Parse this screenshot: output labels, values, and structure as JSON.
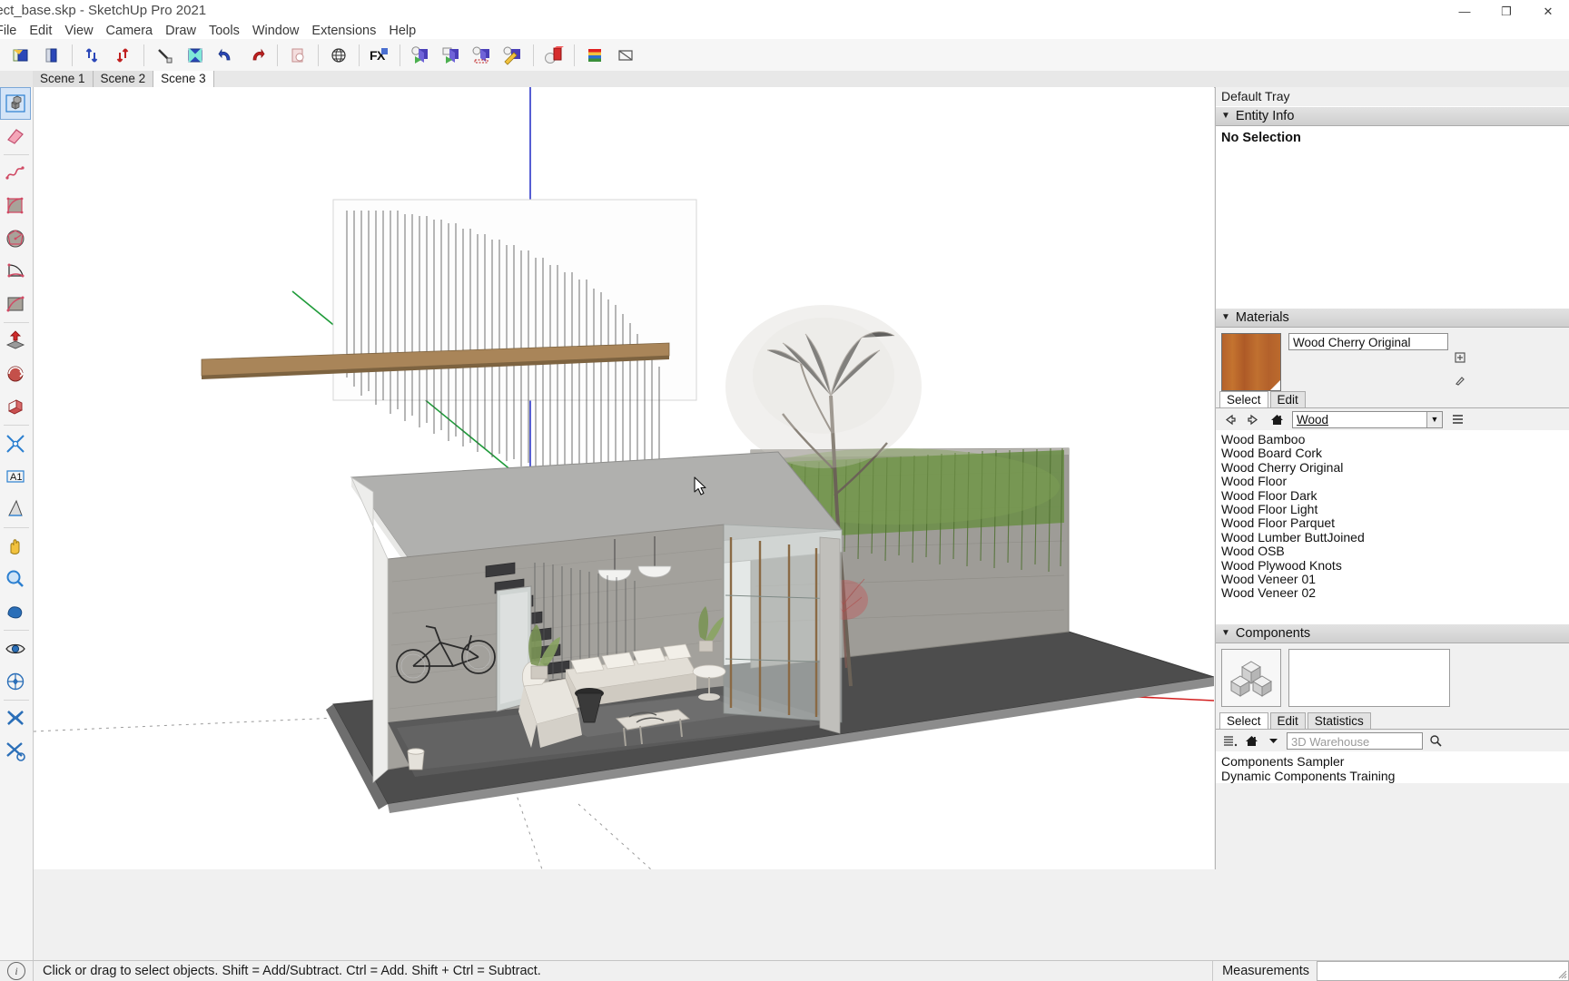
{
  "window": {
    "title": "ject_base.skp - SketchUp Pro 2021",
    "minimize": "—",
    "maximize": "❐",
    "close": "✕"
  },
  "menu": {
    "items": [
      {
        "label": "File"
      },
      {
        "label": "Edit"
      },
      {
        "label": "View"
      },
      {
        "label": "Camera"
      },
      {
        "label": "Draw"
      },
      {
        "label": "Tools"
      },
      {
        "label": "Window"
      },
      {
        "label": "Extensions"
      },
      {
        "label": "Help"
      }
    ]
  },
  "toolbar": {
    "groups": [
      {
        "buttons": [
          {
            "name": "new-document-button",
            "icon": "new-document-icon"
          },
          {
            "name": "open-document-button",
            "icon": "open-document-icon"
          }
        ]
      },
      {
        "buttons": [
          {
            "name": "import-button",
            "icon": "import-arrows-icon"
          },
          {
            "name": "export-button",
            "icon": "export-arrows-icon"
          }
        ]
      },
      {
        "buttons": [
          {
            "name": "cut-button",
            "icon": "cut-icon"
          },
          {
            "name": "copy-button",
            "icon": "copy-icon"
          },
          {
            "name": "undo-button",
            "icon": "undo-arrow-icon"
          },
          {
            "name": "redo-button",
            "icon": "redo-arrow-icon"
          }
        ]
      },
      {
        "buttons": [
          {
            "name": "paste-button",
            "icon": "paste-icon"
          }
        ]
      },
      {
        "buttons": [
          {
            "name": "geolocation-button",
            "icon": "globe-icon"
          }
        ]
      },
      {
        "buttons": [
          {
            "name": "effects-button",
            "icon": "fx-icon"
          }
        ]
      },
      {
        "buttons": [
          {
            "name": "animation-play-button",
            "icon": "play-cube-icon"
          },
          {
            "name": "animation-scene-button",
            "icon": "scene-cube-icon"
          },
          {
            "name": "animation-timeline-button",
            "icon": "timeline-cube-icon"
          },
          {
            "name": "animation-edit-button",
            "icon": "pencil-cube-icon"
          }
        ]
      },
      {
        "buttons": [
          {
            "name": "render-button",
            "icon": "red-cube-icon"
          }
        ]
      },
      {
        "buttons": [
          {
            "name": "materials-palette-button",
            "icon": "color-swatch-icon"
          },
          {
            "name": "section-cut-button",
            "icon": "section-plane-icon"
          }
        ]
      }
    ]
  },
  "scenes": {
    "tabs": [
      {
        "label": "Scene 1",
        "active": false
      },
      {
        "label": "Scene 2",
        "active": false
      },
      {
        "label": "Scene 3",
        "active": true
      }
    ]
  },
  "left_tools": {
    "items": [
      {
        "name": "select-tool",
        "icon": "select-cubes-icon",
        "active": true
      },
      {
        "name": "eraser-tool",
        "icon": "eraser-icon",
        "active": false
      },
      {
        "name": "freehand-tool",
        "icon": "freehand-curve-icon",
        "active": false
      },
      {
        "name": "arc-tool",
        "icon": "arc-icon",
        "active": false
      },
      {
        "name": "polygon-tool",
        "icon": "polygon-icon",
        "active": false
      },
      {
        "name": "pie-tool",
        "icon": "pie-icon",
        "active": false
      },
      {
        "name": "two-point-arc-tool",
        "icon": "two-point-arc-icon",
        "active": false
      },
      {
        "name": "push-pull-tool",
        "icon": "push-pull-icon",
        "active": false
      },
      {
        "name": "follow-me-tool",
        "icon": "follow-me-icon",
        "active": false
      },
      {
        "name": "scale-tool",
        "icon": "scale-icon",
        "active": false
      },
      {
        "name": "tape-measure-tool",
        "icon": "tape-measure-icon",
        "active": false
      },
      {
        "name": "text-tool",
        "icon": "text-label-icon",
        "active": false
      },
      {
        "name": "protractor-tool",
        "icon": "protractor-icon",
        "active": false
      },
      {
        "name": "orbit-tool",
        "icon": "orbit-hand-icon",
        "active": false
      },
      {
        "name": "zoom-tool",
        "icon": "magnifier-icon",
        "active": false
      },
      {
        "name": "pan-tool",
        "icon": "pan-hand-icon",
        "active": false
      },
      {
        "name": "position-camera-tool",
        "icon": "camera-eye-icon",
        "active": false
      },
      {
        "name": "walk-tool",
        "icon": "walk-icon",
        "active": false
      },
      {
        "name": "solid-tools",
        "icon": "solid-tools-icon",
        "active": false
      },
      {
        "name": "sandbox-tools",
        "icon": "sandbox-tools-icon",
        "active": false
      }
    ]
  },
  "tray": {
    "title": "Default Tray",
    "entity_info": {
      "header": "Entity Info",
      "selection": "No Selection"
    },
    "materials": {
      "header": "Materials",
      "current_name": "Wood Cherry Original",
      "tabs": [
        {
          "label": "Select",
          "active": true
        },
        {
          "label": "Edit",
          "active": false
        }
      ],
      "nav": {
        "back": "back-arrow-icon",
        "forward": "forward-arrow-icon",
        "home": "home-icon",
        "collection": "Wood"
      },
      "list": [
        "Wood Bamboo",
        "Wood Board Cork",
        "Wood Cherry Original",
        "Wood Floor",
        "Wood Floor Dark",
        "Wood Floor Light",
        "Wood Floor Parquet",
        "Wood Lumber ButtJoined",
        "Wood OSB",
        "Wood Plywood Knots",
        "Wood Veneer 01",
        "Wood Veneer 02"
      ]
    },
    "components": {
      "header": "Components",
      "tabs": [
        {
          "label": "Select",
          "active": true
        },
        {
          "label": "Edit",
          "active": false
        },
        {
          "label": "Statistics",
          "active": false
        }
      ],
      "search_placeholder": "3D Warehouse",
      "list": [
        "Components Sampler",
        "Dynamic Components Training"
      ]
    }
  },
  "status": {
    "help_icon": "info-icon",
    "message": "Click or drag to select objects. Shift = Add/Subtract. Ctrl = Add. Shift + Ctrl = Subtract.",
    "measurements_label": "Measurements",
    "measurements_value": ""
  },
  "viewport": {
    "model_description": "Architectural sectional model of a modern house with flat roof, concrete walls, living room with sofa, lounge chair, coffee table, pendant lights, staircase, bicycle, planters, sliding glass doors, rear hedge wall and tree"
  },
  "colors": {
    "accent": "#7ba7d7",
    "axis_blue": "#2b36c8",
    "axis_green": "#1f9b3a",
    "axis_red": "#d32020",
    "ground": "#4a4a4a",
    "wall": "#9a9a98",
    "roof": "#9d9d9d"
  }
}
